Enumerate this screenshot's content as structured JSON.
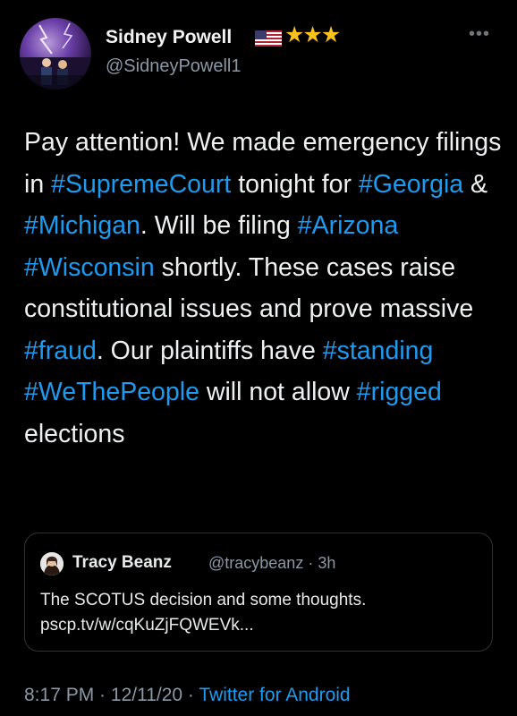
{
  "colors": {
    "background": "#000000",
    "text": "#e7e9ea",
    "secondary_text": "#8b98a5",
    "link_blue": "#1d9bf0",
    "star_gold": "#f7c21c",
    "card_border": "#2f3336"
  },
  "tweet": {
    "author": {
      "name": "Sidney Powell",
      "handle": "@SidneyPowell1",
      "avatar_icon": "avatar-photo",
      "flag_icon": "us-flag-icon",
      "stars": "★★★"
    },
    "more_icon": "•••",
    "body": [
      {
        "text": "Pay attention! We made emergency filings in ",
        "hashtag": false
      },
      {
        "text": "#SupremeCourt",
        "hashtag": true
      },
      {
        "text": " tonight for ",
        "hashtag": false
      },
      {
        "text": "#Georgia",
        "hashtag": true
      },
      {
        "text": " & ",
        "hashtag": false
      },
      {
        "text": "#Michigan",
        "hashtag": true
      },
      {
        "text": ". Will be filing ",
        "hashtag": false
      },
      {
        "text": "#Arizona",
        "hashtag": true
      },
      {
        "text": " ",
        "hashtag": false
      },
      {
        "text": "#Wisconsin",
        "hashtag": true
      },
      {
        "text": " shortly. These cases raise constitutional issues and prove massive ",
        "hashtag": false
      },
      {
        "text": "#fraud",
        "hashtag": true
      },
      {
        "text": ". Our plaintiffs have ",
        "hashtag": false
      },
      {
        "text": "#standing",
        "hashtag": true
      },
      {
        "text": " ",
        "hashtag": false
      },
      {
        "text": "#WeThePeople",
        "hashtag": true
      },
      {
        "text": " will not allow ",
        "hashtag": false
      },
      {
        "text": "#rigged",
        "hashtag": true
      },
      {
        "text": " elections",
        "hashtag": false
      }
    ],
    "quote": {
      "avatar_icon": "quote-avatar-photo",
      "name": "Tracy Beanz",
      "handle": "@tracybeanz",
      "separator": " · ",
      "age": "3h",
      "text_line1": "The SCOTUS decision and some thoughts.",
      "text_line2": "pscp.tv/w/cqKuZjFQWEVk..."
    },
    "footer": {
      "time": "8:17 PM",
      "separator": " · ",
      "date": "12/11/20",
      "source": "Twitter for Android"
    }
  }
}
